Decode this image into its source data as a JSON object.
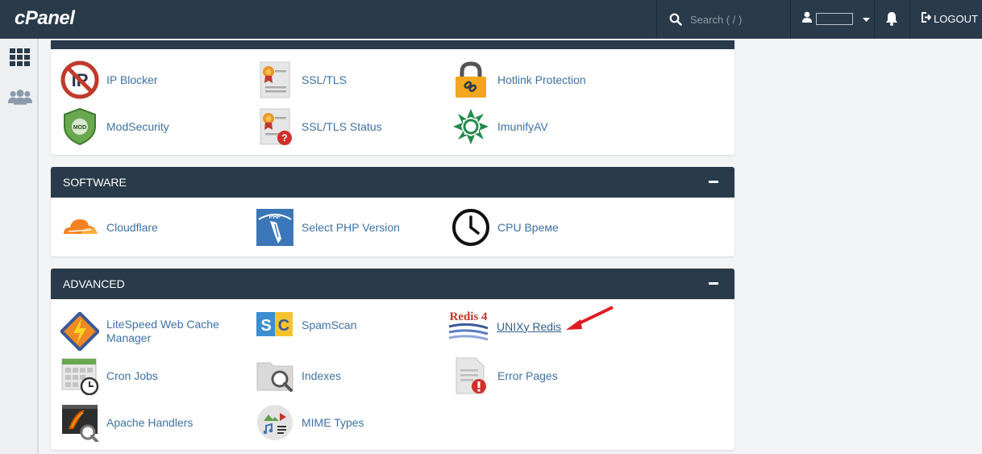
{
  "header": {
    "logo": "cPanel",
    "search_placeholder": "Search ( / )",
    "logout_label": "LOGOUT"
  },
  "sections": {
    "security": {
      "items": [
        "IP Blocker",
        "SSL/TLS",
        "Hotlink Protection",
        "ModSecurity",
        "SSL/TLS Status",
        "ImunifyAV"
      ]
    },
    "software": {
      "title": "SOFTWARE",
      "items": [
        "Cloudflare",
        "Select PHP Version",
        "CPU Време"
      ]
    },
    "advanced": {
      "title": "ADVANCED",
      "items": [
        "LiteSpeed Web Cache Manager",
        "SpamScan",
        "UNIXy Redis",
        "Cron Jobs",
        "Indexes",
        "Error Pages",
        "Apache Handlers",
        "MIME Types"
      ]
    }
  },
  "icons": {
    "redis_badge": "Redis 4",
    "php_badge": "PHP",
    "mod_badge": "MOD"
  },
  "colors": {
    "header_bg": "#293a4a",
    "link": "#3d72a4",
    "annotation_arrow": "#e11b22"
  }
}
